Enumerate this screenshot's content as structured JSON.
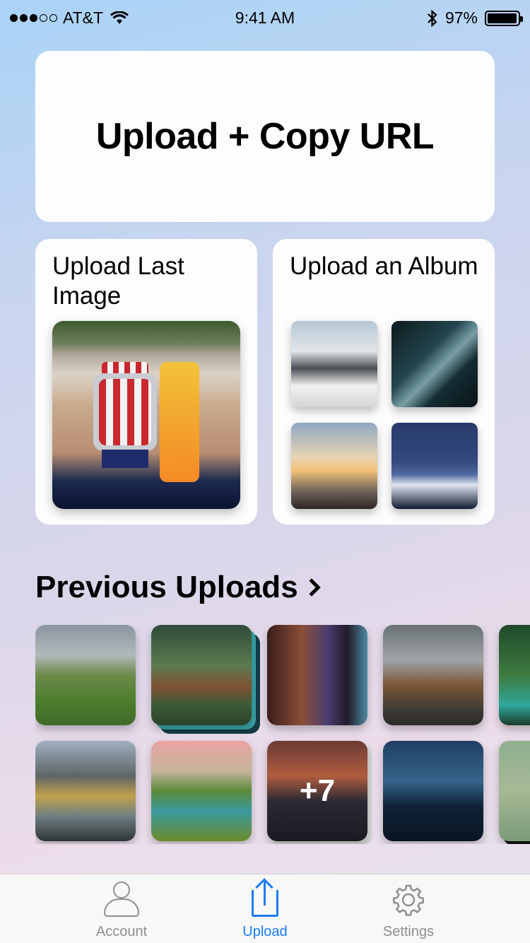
{
  "status_bar": {
    "carrier": "AT&T",
    "time": "9:41 AM",
    "battery_percent": "97%",
    "battery_level": 0.97,
    "signal_bars_filled": 3,
    "signal_bars_total": 5
  },
  "hero": {
    "title": "Upload + Copy URL"
  },
  "cards": {
    "last_image": {
      "title": "Upload Last Image"
    },
    "album": {
      "title": "Upload an Album"
    }
  },
  "previous_uploads": {
    "title": "Previous Uploads",
    "more_count": "+7"
  },
  "tabs": [
    {
      "label": "Account",
      "icon": "person-icon",
      "active": false
    },
    {
      "label": "Upload",
      "icon": "share-icon",
      "active": true
    },
    {
      "label": "Settings",
      "icon": "gear-icon",
      "active": false
    }
  ],
  "colors": {
    "accent": "#1b7cf5",
    "tab_inactive": "#8e8e93"
  }
}
